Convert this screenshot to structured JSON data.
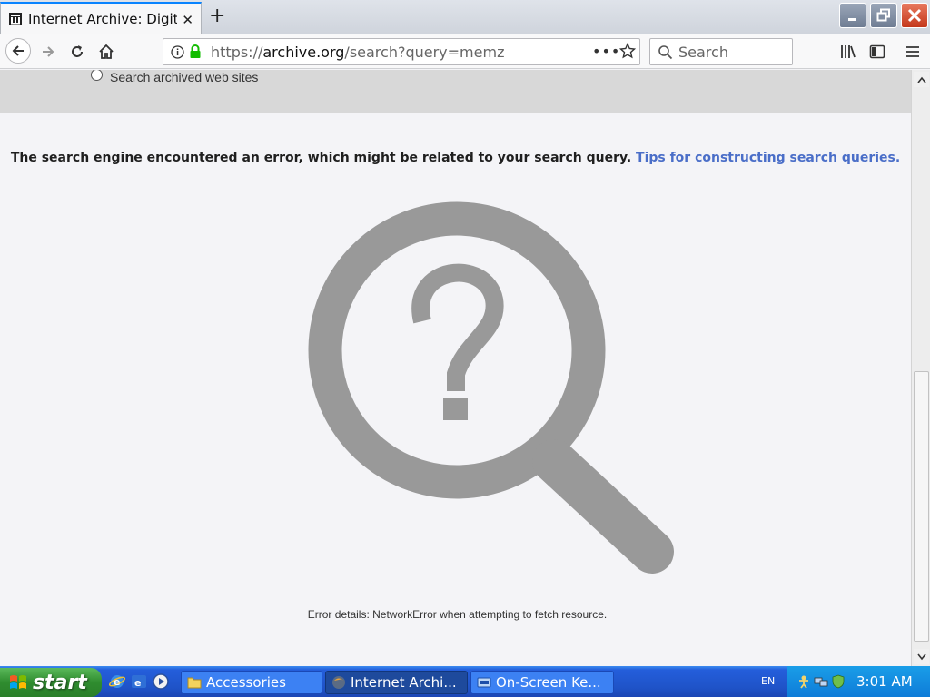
{
  "browser": {
    "tab": {
      "title": "Internet Archive: Digital Library of Free & Borrowable Books, Movies, Music & Wayback Machine",
      "close_glyph": "✕"
    },
    "new_tab_glyph": "+",
    "url": {
      "scheme": "https://",
      "host": "archive.org",
      "path": "/search?query=memz"
    },
    "page_actions_glyph": "•••",
    "search_placeholder": "Search"
  },
  "page": {
    "radio_label": "Search archived web sites",
    "error_message": "The search engine encountered an error, which might be related to your search query.",
    "tips_link": "Tips for constructing search queries.",
    "error_details": "Error details: NetworkError when attempting to fetch resource.",
    "illustration_icon": "magnifier-question-icon",
    "illustration_color": "#999999"
  },
  "taskbar": {
    "start_label": "start",
    "tasks": [
      {
        "label": "Accessories",
        "icon": "folder-icon"
      },
      {
        "label": "Internet Archi...",
        "icon": "firefox-icon"
      },
      {
        "label": "On-Screen Ke...",
        "icon": "keyboard-icon"
      }
    ],
    "language": "EN",
    "clock": "3:01 AM"
  },
  "colors": {
    "link": "#4a6ec8",
    "taskbar": "#245edb",
    "start_button": "#2f8c2f",
    "close_button": "#c4371a"
  }
}
